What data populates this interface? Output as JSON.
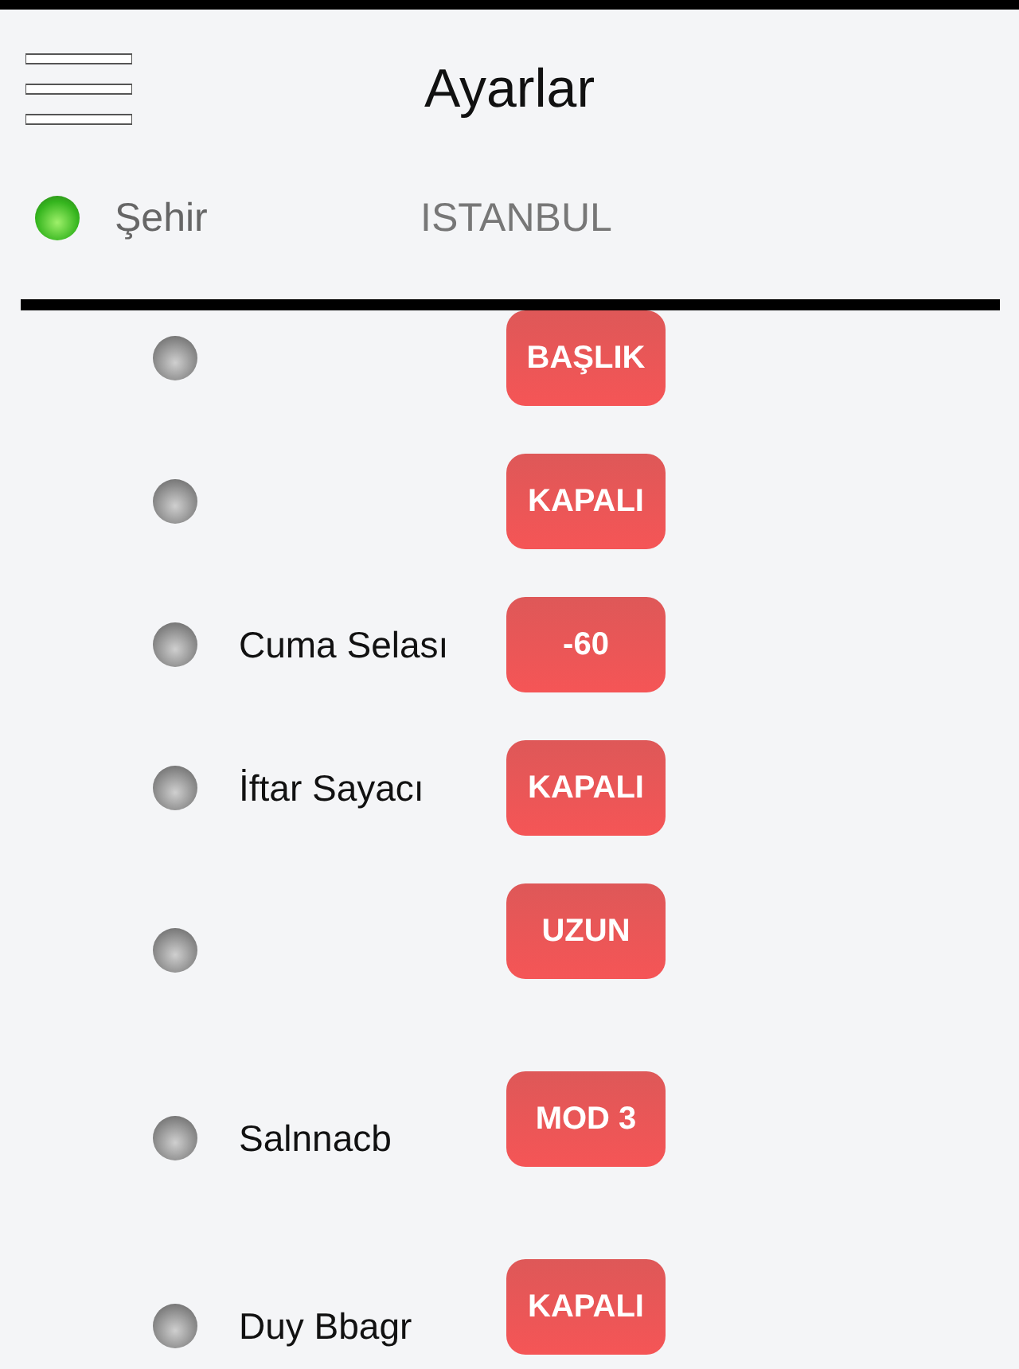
{
  "header": {
    "title": "Ayarlar"
  },
  "city": {
    "label": "Şehir",
    "value": "ISTANBUL",
    "on": true
  },
  "settings": [
    {
      "value": "BAŞLIK",
      "on": false
    },
    {
      "value": "KAPALI",
      "on": false
    },
    {
      "label": "Cuma Selası",
      "value": "-60",
      "on": false
    },
    {
      "label": "İftar Sayacı",
      "value": "KAPALI",
      "on": false
    },
    {
      "value": "UZUN",
      "on": false
    },
    {
      "label": "Salnnacb",
      "value": "MOD 3",
      "on": false
    },
    {
      "label": "Duy Bbagr",
      "value": "KAPALI",
      "on": false
    }
  ]
}
